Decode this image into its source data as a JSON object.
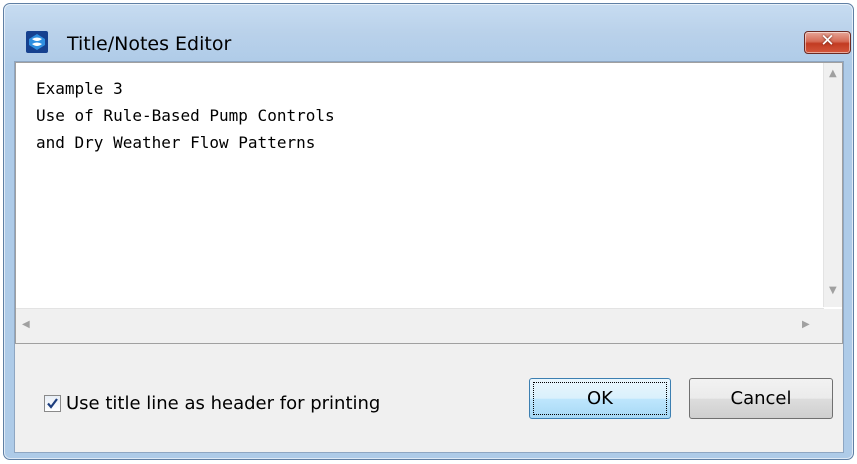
{
  "window": {
    "title": "Title/Notes Editor",
    "close_label": "✕"
  },
  "editor": {
    "text": "Example 3\nUse of Rule-Based Pump Controls\nand Dry Weather Flow Patterns"
  },
  "options": {
    "header_checkbox_label": "Use title line as header for printing",
    "header_checkbox_checked": true
  },
  "buttons": {
    "ok_label": "OK",
    "cancel_label": "Cancel"
  },
  "icons": {
    "app": "app-icon",
    "scroll_up": "arrow-up-icon",
    "scroll_down": "arrow-down-icon",
    "scroll_left": "arrow-left-icon",
    "scroll_right": "arrow-right-icon"
  },
  "colors": {
    "titlebar": "#b9d1ea",
    "close_button": "#c23b22",
    "default_button": "#bee6fd"
  }
}
